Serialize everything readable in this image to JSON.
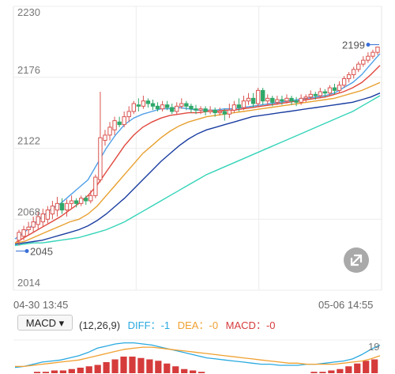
{
  "colors": {
    "up": "#d9534f",
    "down": "#2fa86a",
    "ma5": "#4f9fe8",
    "ma10": "#e0483e",
    "ma20": "#e8a030",
    "ma40": "#1a3da0",
    "ma60": "#34d4b8",
    "diff": "#29a9e0",
    "dea": "#f0a030",
    "macd": "#d63b3b"
  },
  "chart_data": {
    "type": "candlestick",
    "y_axis_labels": [
      "2230",
      "2176",
      "2122",
      "2068",
      "2014"
    ],
    "ylim": [
      2014,
      2230
    ],
    "x_labels": {
      "start": "04-30  13:45",
      "end": "05-06  14:55"
    },
    "annotations": {
      "high": "2199",
      "low": "2045"
    },
    "candles": [
      [
        2052,
        2058,
        2048,
        2060
      ],
      [
        2055,
        2060,
        2052,
        2063
      ],
      [
        2060,
        2062,
        2056,
        2066
      ],
      [
        2062,
        2066,
        2058,
        2070
      ],
      [
        2064,
        2070,
        2060,
        2074
      ],
      [
        2066,
        2072,
        2062,
        2076
      ],
      [
        2068,
        2075,
        2065,
        2078
      ],
      [
        2072,
        2078,
        2068,
        2082
      ],
      [
        2075,
        2080,
        2070,
        2085
      ],
      [
        2080,
        2075,
        2072,
        2084
      ],
      [
        2075,
        2080,
        2070,
        2083
      ],
      [
        2080,
        2082,
        2076,
        2086
      ],
      [
        2082,
        2080,
        2077,
        2084
      ],
      [
        2080,
        2084,
        2078,
        2086
      ],
      [
        2084,
        2082,
        2079,
        2086
      ],
      [
        2082,
        2086,
        2080,
        2090
      ],
      [
        2086,
        2100,
        2084,
        2102
      ],
      [
        2098,
        2130,
        2096,
        2165
      ],
      [
        2128,
        2132,
        2124,
        2136
      ],
      [
        2132,
        2138,
        2128,
        2142
      ],
      [
        2136,
        2143,
        2132,
        2146
      ],
      [
        2142,
        2140,
        2138,
        2146
      ],
      [
        2140,
        2146,
        2138,
        2150
      ],
      [
        2146,
        2150,
        2142,
        2154
      ],
      [
        2150,
        2156,
        2148,
        2158
      ],
      [
        2155,
        2154,
        2150,
        2160
      ],
      [
        2154,
        2158,
        2152,
        2162
      ],
      [
        2158,
        2156,
        2153,
        2160
      ],
      [
        2156,
        2154,
        2151,
        2159
      ],
      [
        2154,
        2152,
        2150,
        2157
      ],
      [
        2152,
        2155,
        2150,
        2158
      ],
      [
        2155,
        2153,
        2151,
        2158
      ],
      [
        2153,
        2150,
        2148,
        2156
      ],
      [
        2150,
        2154,
        2148,
        2157
      ],
      [
        2154,
        2156,
        2152,
        2160
      ],
      [
        2156,
        2154,
        2151,
        2158
      ],
      [
        2154,
        2152,
        2149,
        2156
      ],
      [
        2152,
        2151,
        2148,
        2155
      ],
      [
        2151,
        2152,
        2148,
        2154
      ],
      [
        2152,
        2150,
        2147,
        2154
      ],
      [
        2150,
        2151,
        2148,
        2154
      ],
      [
        2151,
        2149,
        2146,
        2153
      ],
      [
        2149,
        2150,
        2147,
        2153
      ],
      [
        2150,
        2148,
        2143,
        2152
      ],
      [
        2148,
        2151,
        2145,
        2156
      ],
      [
        2151,
        2155,
        2149,
        2158
      ],
      [
        2155,
        2153,
        2150,
        2160
      ],
      [
        2153,
        2158,
        2151,
        2162
      ],
      [
        2158,
        2160,
        2155,
        2164
      ],
      [
        2160,
        2156,
        2153,
        2164
      ],
      [
        2156,
        2166,
        2154,
        2168
      ],
      [
        2166,
        2158,
        2155,
        2168
      ],
      [
        2158,
        2160,
        2155,
        2163
      ],
      [
        2160,
        2157,
        2154,
        2162
      ],
      [
        2157,
        2159,
        2155,
        2162
      ],
      [
        2159,
        2158,
        2155,
        2162
      ],
      [
        2158,
        2160,
        2156,
        2163
      ],
      [
        2160,
        2158,
        2155,
        2162
      ],
      [
        2158,
        2157,
        2154,
        2161
      ],
      [
        2157,
        2160,
        2155,
        2163
      ],
      [
        2160,
        2161,
        2157,
        2163
      ],
      [
        2161,
        2163,
        2159,
        2166
      ],
      [
        2163,
        2162,
        2159,
        2165
      ],
      [
        2162,
        2165,
        2160,
        2168
      ],
      [
        2165,
        2164,
        2161,
        2167
      ],
      [
        2164,
        2168,
        2162,
        2170
      ],
      [
        2168,
        2166,
        2163,
        2171
      ],
      [
        2166,
        2170,
        2164,
        2173
      ],
      [
        2170,
        2175,
        2168,
        2177
      ],
      [
        2175,
        2178,
        2172,
        2180
      ],
      [
        2178,
        2182,
        2175,
        2184
      ],
      [
        2182,
        2186,
        2180,
        2188
      ],
      [
        2186,
        2189,
        2184,
        2192
      ],
      [
        2189,
        2192,
        2187,
        2195
      ],
      [
        2192,
        2195,
        2190,
        2197
      ],
      [
        2195,
        2199,
        2193,
        2199
      ]
    ],
    "ma_series": [
      {
        "key": "ma5",
        "values": [
          2053,
          2058,
          2064,
          2070,
          2076,
          2080,
          2086,
          2092,
          2098,
          2110,
          2122,
          2132,
          2140,
          2145,
          2148,
          2150,
          2152,
          2152,
          2153,
          2152,
          2151,
          2151,
          2151,
          2152,
          2152,
          2153,
          2154,
          2155,
          2156,
          2157,
          2158,
          2159,
          2160,
          2161,
          2162,
          2164,
          2168,
          2172,
          2178,
          2186,
          2194
        ]
      },
      {
        "key": "ma10",
        "values": [
          2050,
          2054,
          2058,
          2062,
          2066,
          2070,
          2075,
          2080,
          2086,
          2094,
          2104,
          2114,
          2124,
          2132,
          2138,
          2142,
          2145,
          2147,
          2148,
          2149,
          2149,
          2150,
          2150,
          2151,
          2151,
          2152,
          2153,
          2154,
          2155,
          2156,
          2157,
          2158,
          2159,
          2160,
          2161,
          2163,
          2165,
          2168,
          2172,
          2178,
          2185
        ]
      },
      {
        "key": "ma20",
        "values": [
          2050,
          2051,
          2054,
          2057,
          2060,
          2063,
          2066,
          2068,
          2072,
          2078,
          2086,
          2094,
          2102,
          2110,
          2118,
          2124,
          2130,
          2135,
          2139,
          2142,
          2144,
          2146,
          2147,
          2148,
          2149,
          2150,
          2151,
          2152,
          2153,
          2154,
          2155,
          2156,
          2157,
          2158,
          2159,
          2160,
          2162,
          2164,
          2166,
          2169,
          2172
        ]
      },
      {
        "key": "ma40",
        "values": [
          2049,
          2050,
          2051,
          2052,
          2054,
          2056,
          2058,
          2060,
          2063,
          2067,
          2072,
          2078,
          2084,
          2091,
          2098,
          2105,
          2112,
          2118,
          2124,
          2129,
          2133,
          2136,
          2138,
          2140,
          2142,
          2144,
          2146,
          2147,
          2148,
          2149,
          2150,
          2151,
          2152,
          2153,
          2154,
          2155,
          2156,
          2157,
          2159,
          2161,
          2164
        ]
      },
      {
        "key": "ma60",
        "values": [
          2048,
          2049,
          2050,
          2050,
          2051,
          2052,
          2053,
          2054,
          2056,
          2058,
          2060,
          2063,
          2066,
          2070,
          2074,
          2078,
          2082,
          2086,
          2090,
          2094,
          2098,
          2102,
          2105,
          2108,
          2111,
          2114,
          2117,
          2120,
          2123,
          2126,
          2129,
          2132,
          2135,
          2138,
          2141,
          2144,
          2147,
          2150,
          2154,
          2158,
          2162
        ]
      }
    ],
    "macd": {
      "params": "(12,26,9)",
      "legend": [
        {
          "label": "DIFF：",
          "value": "-1",
          "color": "#29a9e0"
        },
        {
          "label": "DEA：",
          "value": "-0",
          "color": "#f0a030"
        },
        {
          "label": "MACD：",
          "value": "-0",
          "color": "#d63b3b"
        }
      ],
      "corner_value": "19",
      "diff": [
        -2,
        -1,
        1,
        3,
        4,
        5,
        7,
        9,
        12,
        16,
        18,
        20,
        21,
        21,
        20,
        19,
        17,
        15,
        13,
        11,
        9,
        7,
        6,
        5,
        4,
        3,
        2,
        1,
        1,
        0,
        0,
        0,
        1,
        1,
        2,
        3,
        4,
        6,
        10,
        15,
        19
      ],
      "dea": [
        -1,
        -1,
        0,
        1,
        2,
        3,
        4,
        5,
        7,
        9,
        11,
        13,
        15,
        16,
        17,
        17,
        16,
        15,
        14,
        13,
        12,
        11,
        10,
        9,
        8,
        7,
        6,
        5,
        4,
        3,
        2,
        2,
        1,
        1,
        1,
        1,
        2,
        3,
        4,
        6,
        9
      ],
      "hist": [
        0,
        0,
        1,
        1,
        2,
        2,
        3,
        4,
        5,
        6,
        8,
        10,
        12,
        12,
        11,
        10,
        9,
        7,
        5,
        3,
        2,
        1,
        0,
        0,
        0,
        0,
        0,
        0,
        0,
        0,
        0,
        0,
        0,
        0,
        1,
        1,
        2,
        3,
        5,
        7,
        9,
        10
      ]
    }
  },
  "ui": {
    "macd_button": "MACD ▾",
    "params": "(12,26,9)",
    "expand_icon": "expand-icon"
  }
}
